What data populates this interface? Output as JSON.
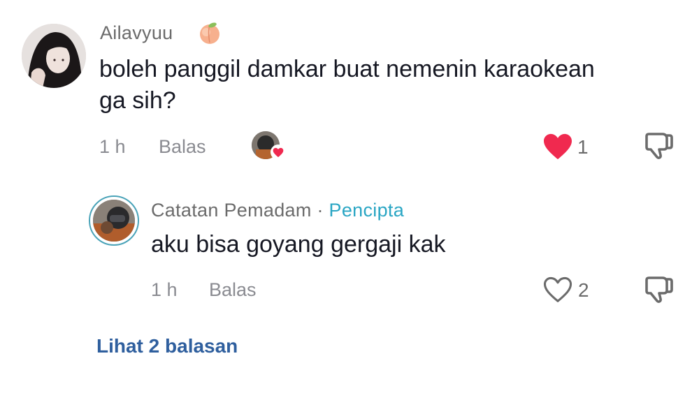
{
  "comment": {
    "username": "Ailavyuu",
    "username_emoji": "peach-emoji",
    "text_line1": "boleh panggil damkar buat nemenin karaokean",
    "text_line2": "ga sih?",
    "time": "1 h",
    "reply_label": "Balas",
    "like_count": "1",
    "liked": true
  },
  "reply": {
    "username": "Catatan Pemadam",
    "separator": "·",
    "badge": "Pencipta",
    "text": "aku bisa goyang gergaji kak",
    "time": "1 h",
    "reply_label": "Balas",
    "like_count": "2",
    "liked": false
  },
  "view_replies": "Lihat 2 balasan",
  "colors": {
    "like_red": "#f0294f",
    "creator_blue": "#2aa6c4",
    "link_blue": "#2f5f9e"
  }
}
